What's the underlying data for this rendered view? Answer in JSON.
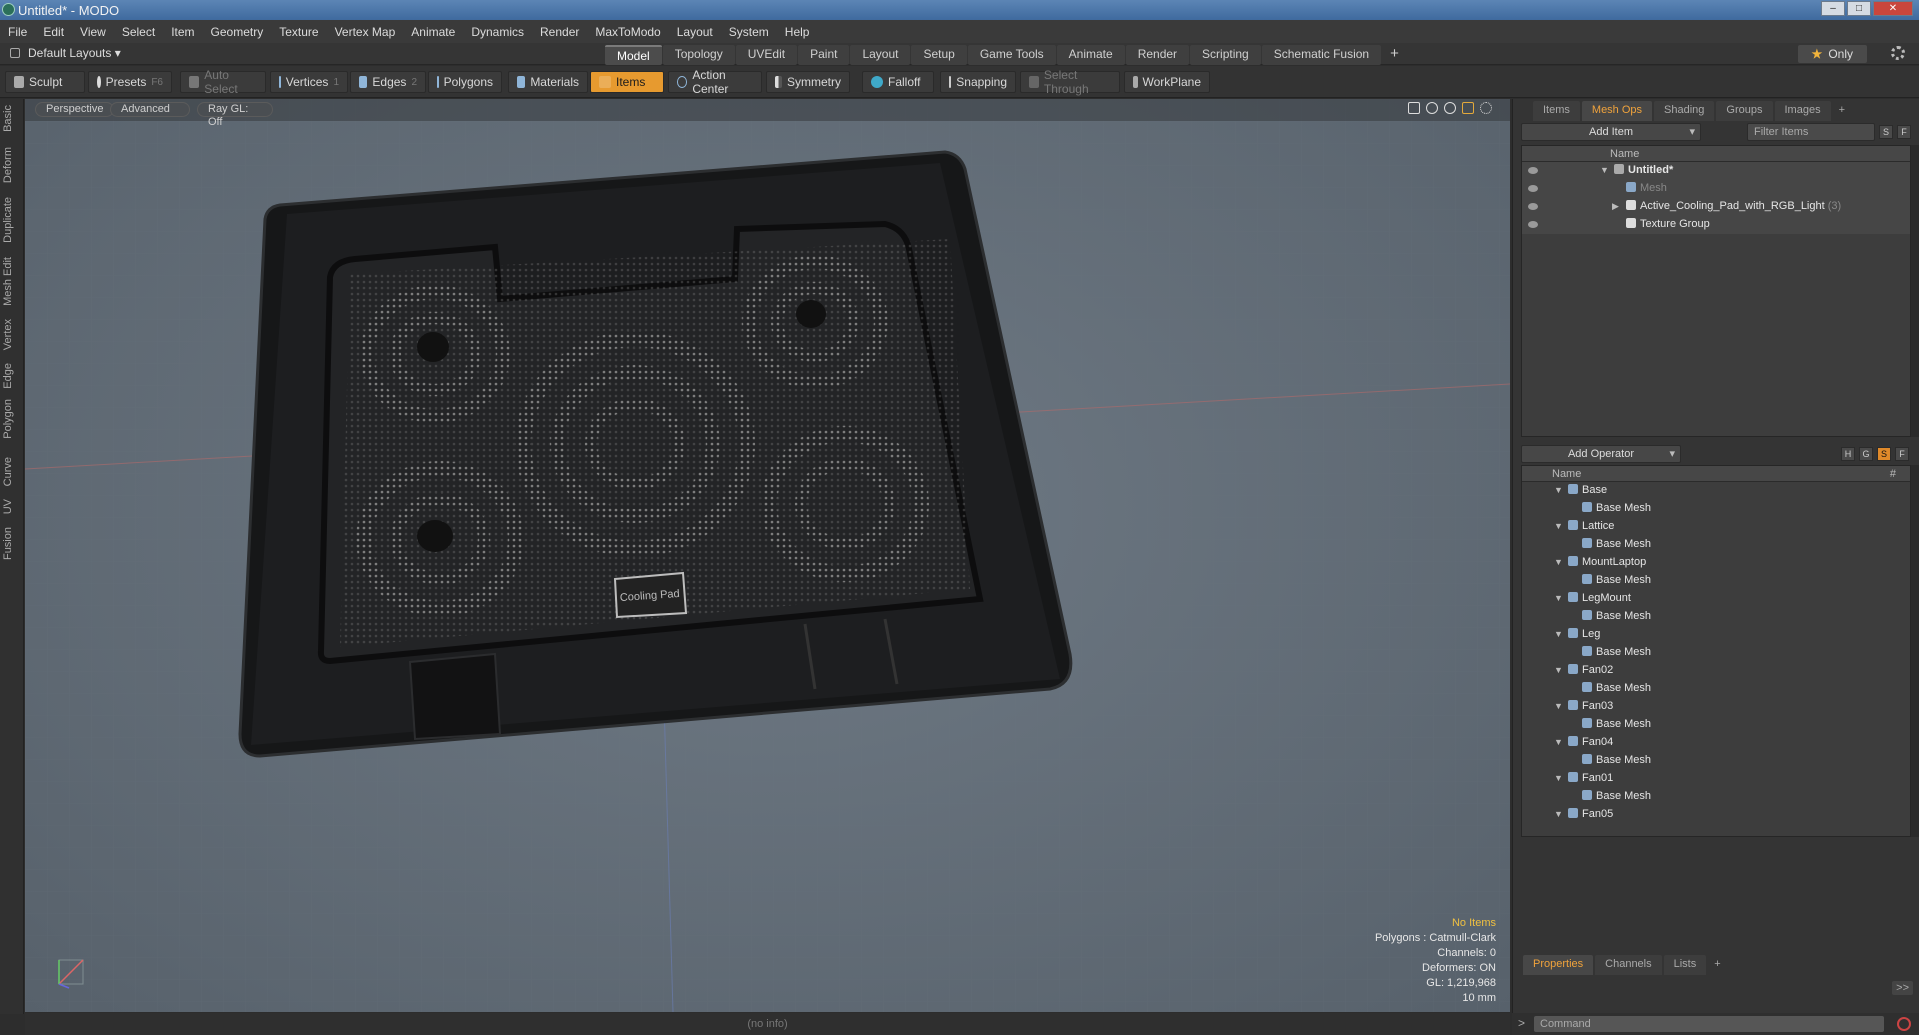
{
  "window": {
    "title": "Untitled* - MODO"
  },
  "menu": [
    "File",
    "Edit",
    "View",
    "Select",
    "Item",
    "Geometry",
    "Texture",
    "Vertex Map",
    "Animate",
    "Dynamics",
    "Render",
    "MaxToModo",
    "Layout",
    "System",
    "Help"
  ],
  "layout": {
    "selector": "Default Layouts ▾",
    "tabs": [
      "Model",
      "Topology",
      "UVEdit",
      "Paint",
      "Layout",
      "Setup",
      "Game Tools",
      "Animate",
      "Render",
      "Scripting",
      "Schematic Fusion"
    ],
    "active_tab": "Model",
    "plus": "+",
    "only_label": "Only",
    "only_star": "★"
  },
  "toolbar": {
    "sculpt": "Sculpt",
    "presets": "Presets",
    "presets_key": "F6",
    "auto_select": "Auto Select",
    "vertices": "Vertices",
    "vertices_count": "1",
    "edges": "Edges",
    "edges_count": "2",
    "polygons": "Polygons",
    "materials": "Materials",
    "items": "Items",
    "action_center": "Action Center",
    "symmetry": "Symmetry",
    "falloff": "Falloff",
    "snapping": "Snapping",
    "select_through": "Select Through",
    "workplane": "WorkPlane"
  },
  "left_tabs": [
    "Basic",
    "Deform",
    "Duplicate",
    "Mesh Edit",
    "Vertex",
    "Edge",
    "Polygon",
    "Curve",
    "UV",
    "Fusion"
  ],
  "viewport": {
    "view": "Perspective",
    "shading": "Advanced",
    "raygl": "Ray GL: Off",
    "badge_text": "Cooling Pad",
    "hud": {
      "no_items": "No Items",
      "polygons": "Polygons : Catmull-Clark",
      "channels": "Channels: 0",
      "deformers": "Deformers: ON",
      "gl": "GL: 1,219,968",
      "scale": "10 mm"
    }
  },
  "items_panel": {
    "tabs": [
      "Items",
      "Mesh Ops",
      "Shading",
      "Groups",
      "Images"
    ],
    "active_tab": "Mesh Ops",
    "plus": "+",
    "add_item": "Add Item",
    "filter": "Filter Items",
    "s_btn": "S",
    "f_btn": "F",
    "col_name": "Name",
    "rows": [
      {
        "label": "Untitled*",
        "count": ""
      },
      {
        "label": "Mesh",
        "count": ""
      },
      {
        "label": "Active_Cooling_Pad_with_RGB_Light",
        "count": "(3)"
      },
      {
        "label": "Texture Group",
        "count": ""
      }
    ]
  },
  "ops_panel": {
    "add_operator": "Add Operator",
    "h_btn": "H",
    "g_btn": "G",
    "s_btn": "S",
    "f_btn": "F",
    "col_name": "Name",
    "col_hash": "#",
    "rows": [
      {
        "label": "Base",
        "child": "Base Mesh"
      },
      {
        "label": "Lattice",
        "child": "Base Mesh"
      },
      {
        "label": "MountLaptop",
        "child": "Base Mesh"
      },
      {
        "label": "LegMount",
        "child": "Base Mesh"
      },
      {
        "label": "Leg",
        "child": "Base Mesh"
      },
      {
        "label": "Fan02",
        "child": "Base Mesh"
      },
      {
        "label": "Fan03",
        "child": "Base Mesh"
      },
      {
        "label": "Fan04",
        "child": "Base Mesh"
      },
      {
        "label": "Fan01",
        "child": "Base Mesh"
      },
      {
        "label": "Fan05",
        "child": ""
      }
    ]
  },
  "props_panel": {
    "tabs": [
      "Properties",
      "Channels",
      "Lists"
    ],
    "active_tab": "Properties",
    "plus": "+",
    "expand": ">>"
  },
  "status": {
    "info": "(no info)",
    "command_placeholder": "Command",
    "prompt": ">"
  }
}
